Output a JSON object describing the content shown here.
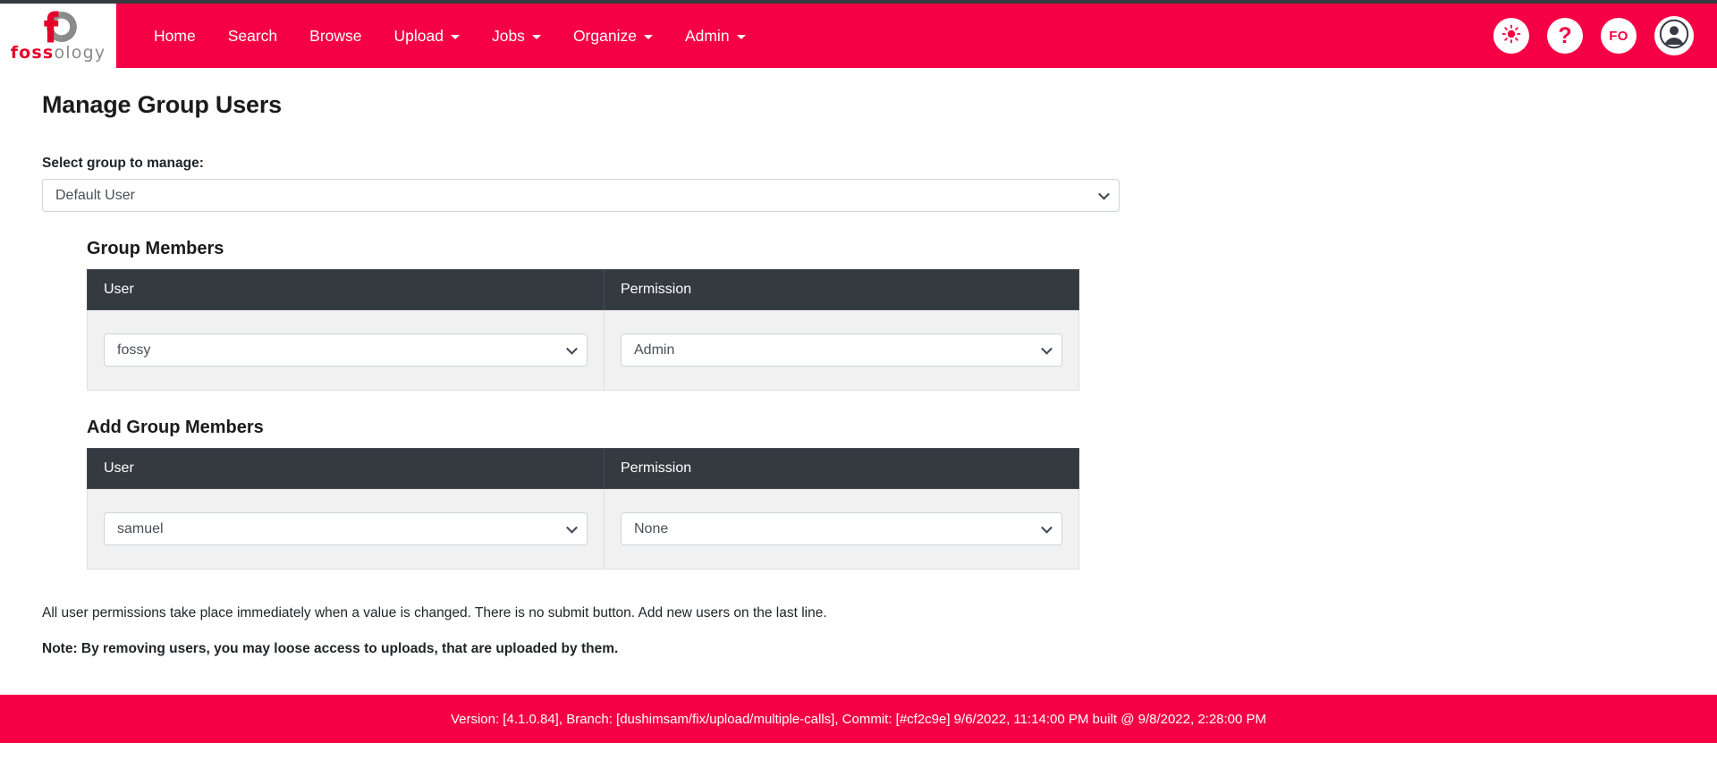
{
  "theme": {
    "brand_red": "#f50044",
    "dark_header": "#343a40",
    "row_bg": "#f1f1f1",
    "logo_red": "#e4002b",
    "logo_grey": "#8a8a8a"
  },
  "header": {
    "logo": {
      "icon": "fossology-logo-icon",
      "word_bold": "foss",
      "word_light": "ology"
    },
    "nav": [
      {
        "label": "Home",
        "has_caret": false
      },
      {
        "label": "Search",
        "has_caret": false
      },
      {
        "label": "Browse",
        "has_caret": false
      },
      {
        "label": "Upload",
        "has_caret": true
      },
      {
        "label": "Jobs",
        "has_caret": true
      },
      {
        "label": "Organize",
        "has_caret": true
      },
      {
        "label": "Admin",
        "has_caret": true
      }
    ],
    "actions": {
      "theme_toggle_icon": "sun-icon",
      "help_label": "?",
      "group_badge_label": "FO",
      "user_avatar_icon": "user-avatar-icon"
    }
  },
  "page": {
    "title": "Manage Group Users"
  },
  "group_selector": {
    "label": "Select group to manage:",
    "value": "Default User"
  },
  "group_members": {
    "title": "Group Members",
    "columns": [
      "User",
      "Permission"
    ],
    "rows": [
      {
        "user": "fossy",
        "permission": "Admin"
      }
    ]
  },
  "add_group_members": {
    "title": "Add Group Members",
    "columns": [
      "User",
      "Permission"
    ],
    "rows": [
      {
        "user": "samuel",
        "permission": "None"
      }
    ]
  },
  "notes": {
    "line1": "All user permissions take place immediately when a value is changed. There is no submit button. Add new users on the last line.",
    "line2": "Note: By removing users, you may loose access to uploads, that are uploaded by them."
  },
  "footer": {
    "text": "Version: [4.1.0.84], Branch: [dushimsam/fix/upload/multiple-calls], Commit: [#cf2c9e] 9/6/2022, 11:14:00 PM built @ 9/8/2022, 2:28:00 PM"
  }
}
